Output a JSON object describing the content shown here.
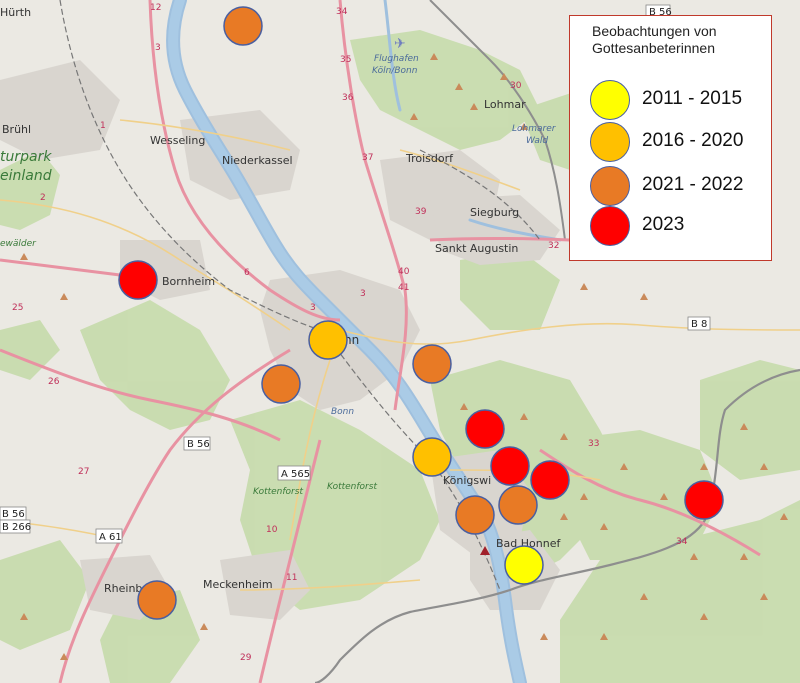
{
  "legend": {
    "title_line1": "Beobachtungen von",
    "title_line2": "Gottesanbeterinnen",
    "items": [
      {
        "label": "2011 - 2015",
        "color": "#ffff00"
      },
      {
        "label": "2016 - 2020",
        "color": "#ffc000"
      },
      {
        "label": "2021 - 2022",
        "color": "#e87a25"
      },
      {
        "label": "2023",
        "color": "#ff0000"
      }
    ]
  },
  "places": {
    "huerth": "Hürth",
    "bruehl": "Brühl",
    "wesseling": "Wesseling",
    "niederkassel": "Niederkassel",
    "troisdorf": "Troisdorf",
    "siegburg": "Siegburg",
    "sankt_augustin": "Sankt Augustin",
    "lohmar": "Lohmar",
    "bornheim": "Bornheim",
    "bonn": "nn",
    "bonn_district": "Bonn",
    "koenigswinter": "Königswi",
    "bad_honnef": "Bad Honnef",
    "meckenheim": "Meckenheim",
    "rheinbach": "Rheinb",
    "airport_line1": "Flughafen",
    "airport_line2": "Köln/Bonn",
    "lohmarer_line1": "Lohmarer",
    "lohmarer_line2": "Wald",
    "kottenforst": "Kottenforst",
    "kottenforst_left": "Kottenforst",
    "naturpark_line1": "turpark",
    "naturpark_line2": "einland",
    "waelder": "ewälder"
  },
  "shields": {
    "b56_top": "B 56",
    "b8": "B 8",
    "b56": "B 56",
    "a565": "A 565",
    "a61": "A 61",
    "b56_left": "B 56",
    "b266": "B 266"
  },
  "observations": [
    {
      "period": "2021 - 2022"
    },
    {
      "period": "2023"
    },
    {
      "period": "2016 - 2020"
    },
    {
      "period": "2021 - 2022"
    },
    {
      "period": "2021 - 2022"
    },
    {
      "period": "2023"
    },
    {
      "period": "2016 - 2020"
    },
    {
      "period": "2023"
    },
    {
      "period": "2023"
    },
    {
      "period": "2021 - 2022"
    },
    {
      "period": "2021 - 2022"
    },
    {
      "period": "2011 - 2015"
    },
    {
      "period": "2021 - 2022"
    },
    {
      "period": "2023"
    }
  ]
}
